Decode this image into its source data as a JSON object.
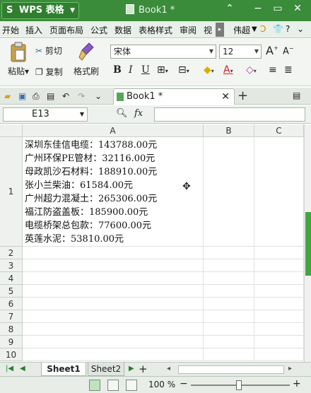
{
  "titlebar": {
    "app_name": "WPS 表格",
    "app_logo": "S",
    "document_title": "Book1 *"
  },
  "menu": {
    "items": [
      "开始",
      "插入",
      "页面布局",
      "公式",
      "数据",
      "表格样式",
      "审阅",
      "视"
    ],
    "user": "伟超"
  },
  "ribbon": {
    "paste_label": "粘贴",
    "cut_label": "剪切",
    "copy_label": "复制",
    "format_painter_label": "格式刷",
    "font_name": "宋体",
    "font_size": "12",
    "bold": "B",
    "italic": "I",
    "underline": "U",
    "grow_font": "A",
    "shrink_font": "A"
  },
  "tabs": {
    "active_tab": "Book1 *"
  },
  "formula_bar": {
    "cell_ref": "E13",
    "fx": "fx",
    "formula_value": ""
  },
  "grid": {
    "columns": [
      "A",
      "B",
      "C"
    ],
    "rows": [
      "1",
      "2",
      "3",
      "4",
      "5",
      "6",
      "7",
      "8",
      "9",
      "10"
    ],
    "cell_A1_lines": [
      "深圳东佳信电缆：143788.00元",
      "广州环保PE管材：32116.00元",
      "母政凯沙石材料：188910.00元",
      "张小兰柴油：61584.00元",
      "广州超力混凝土：265306.00元",
      "福江防盗盖板：185900.00元",
      "电缆桥架总包款：77600.00元",
      "英莲水泥：53810.00元"
    ]
  },
  "sheets": {
    "tabs": [
      "Sheet1",
      "Sheet2"
    ],
    "active": "Sheet1"
  },
  "status": {
    "zoom": "100 %"
  }
}
